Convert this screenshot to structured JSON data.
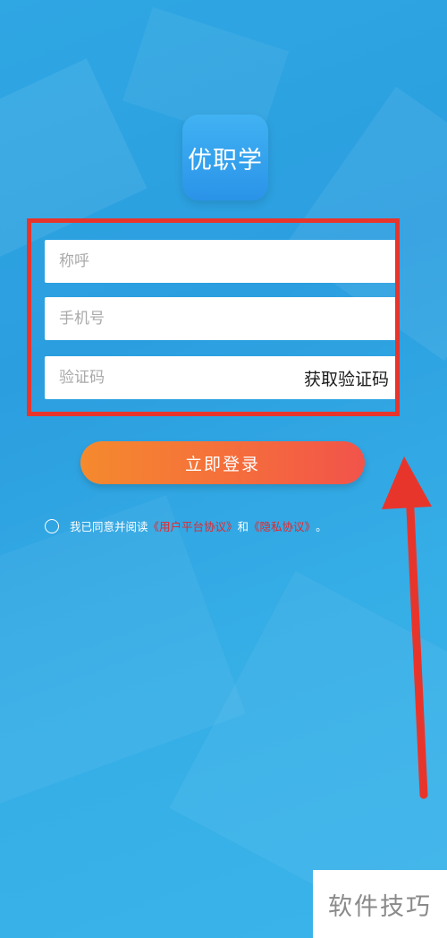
{
  "app": {
    "logo_text": "优职学"
  },
  "form": {
    "nickname_placeholder": "称呼",
    "phone_placeholder": "手机号",
    "code_placeholder": "验证码",
    "get_code_label": "获取验证码"
  },
  "login_button": {
    "label": "立即登录"
  },
  "agreement": {
    "prefix": "我已同意并阅读",
    "user_agreement": "《用户平台协议》",
    "conjunction": "和",
    "privacy_policy": "《隐私协议》",
    "suffix": "。"
  },
  "watermark": {
    "text": "软件技巧"
  },
  "colors": {
    "background": "#2fa7e3",
    "highlight": "#e8352c",
    "button_start": "#f58a2e",
    "button_end": "#f2534a",
    "link": "#e6262a"
  }
}
